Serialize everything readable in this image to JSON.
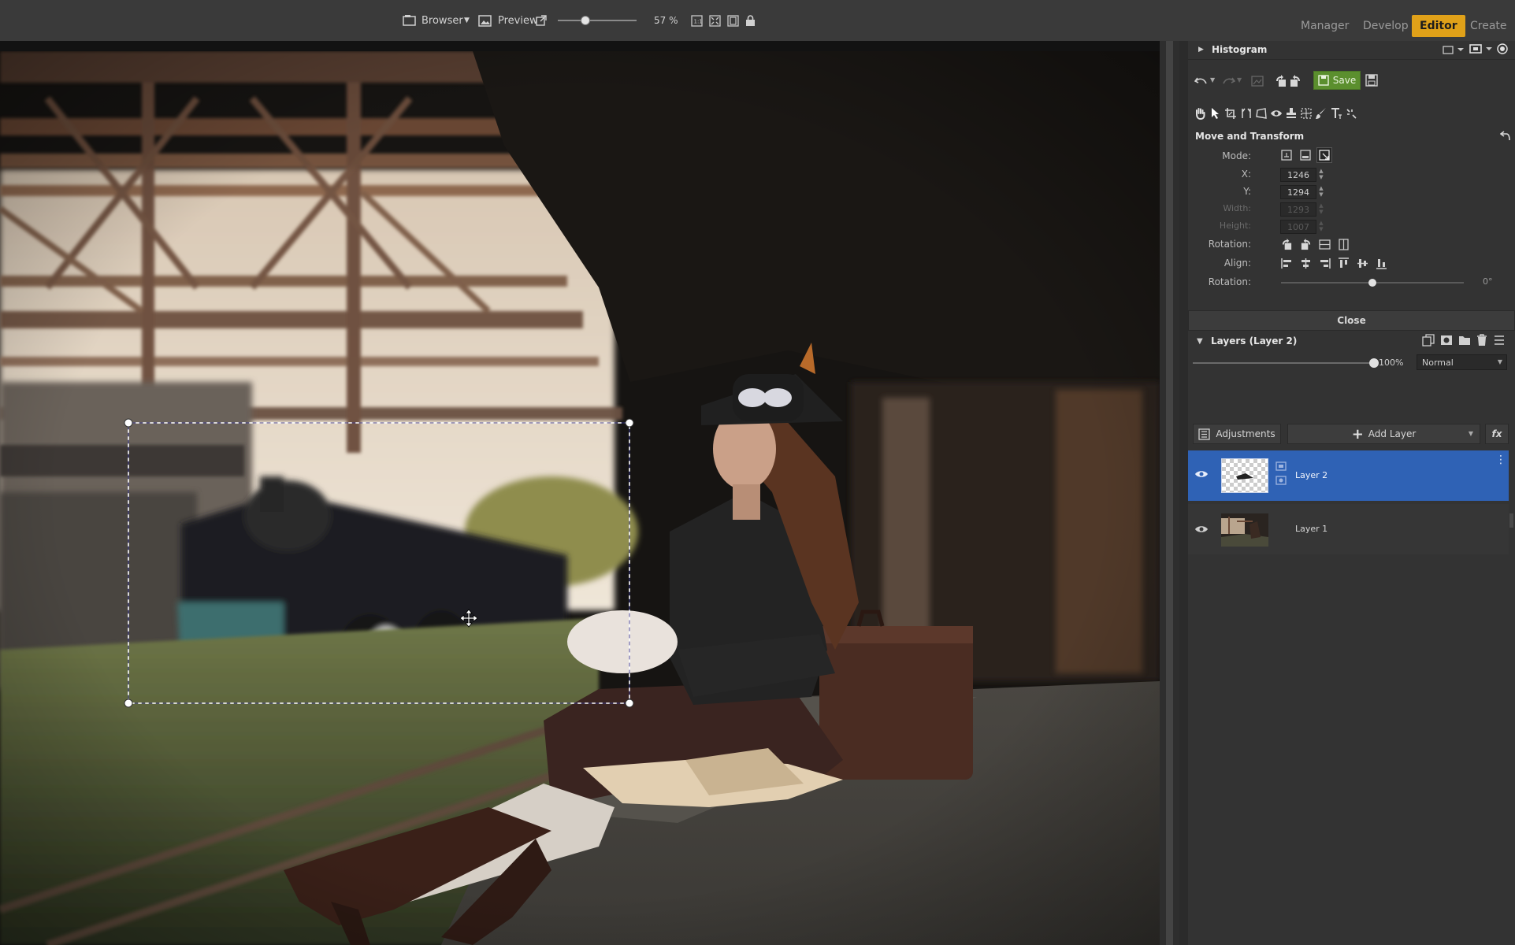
{
  "toolbar": {
    "browser_label": "Browser",
    "preview_label": "Preview",
    "zoom_value": "57 %",
    "zoom_fraction": 0.35
  },
  "mode_tabs": [
    "Manager",
    "Develop",
    "Editor",
    "Create"
  ],
  "active_mode": "Editor",
  "panel": {
    "histogram_title": "Histogram",
    "save_label": "Save",
    "transform_title": "Move and Transform",
    "mode_label": "Mode:",
    "x_label": "X:",
    "x_value": "1246",
    "y_label": "Y:",
    "y_value": "1294",
    "width_label": "Width:",
    "width_value": "1293",
    "height_label": "Height:",
    "height_value": "1007",
    "rotation_label": "Rotation:",
    "align_label": "Align:",
    "rotation_slider_label": "Rotation:",
    "rotation_value": "0°",
    "rotation_fraction": 0.5,
    "close_label": "Close",
    "layers_title": "Layers (Layer 2)",
    "opacity_value": "100%",
    "opacity_fraction": 1.0,
    "blend_mode": "Normal",
    "adjustments_label": "Adjustments",
    "add_layer_label": "Add Layer",
    "fx_label": "fx",
    "layers": [
      {
        "name": "Layer 2",
        "selected": true
      },
      {
        "name": "Layer 1",
        "selected": false
      }
    ]
  },
  "colors": {
    "accent": "#e0a119",
    "save_green": "#5b8f2e",
    "selection_blue": "#2f62b5"
  }
}
